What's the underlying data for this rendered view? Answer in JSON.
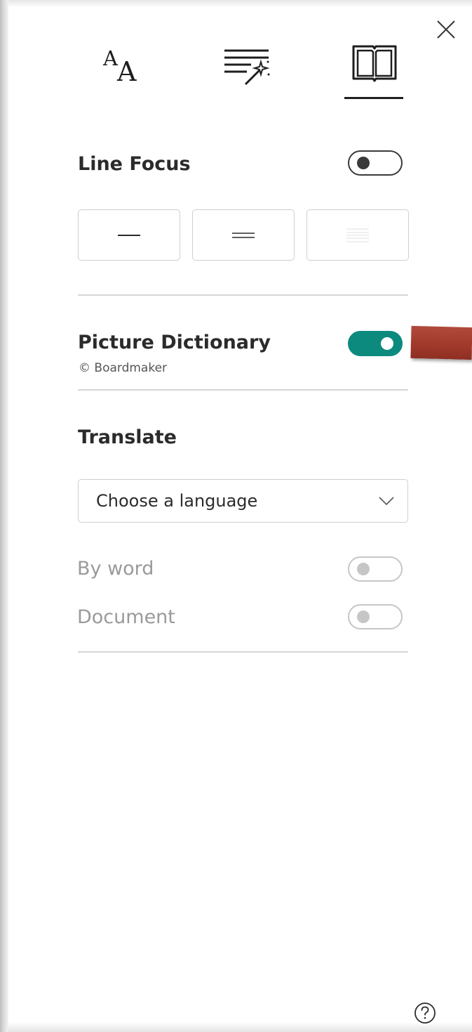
{
  "tabs": [
    {
      "id": "text-preferences",
      "icon": "text-size-icon",
      "label": "AA"
    },
    {
      "id": "grammar-options",
      "icon": "grammar-options-icon"
    },
    {
      "id": "reading-preferences",
      "icon": "book-icon",
      "selected": true
    }
  ],
  "line_focus": {
    "title": "Line Focus",
    "enabled": false,
    "options": [
      {
        "id": "one-line",
        "icon": "one-line-icon"
      },
      {
        "id": "three-lines",
        "icon": "three-lines-icon"
      },
      {
        "id": "five-lines",
        "icon": "five-lines-icon"
      }
    ]
  },
  "picture_dictionary": {
    "title": "Picture Dictionary",
    "credit": "© Boardmaker",
    "enabled": true
  },
  "translate": {
    "title": "Translate",
    "language_placeholder": "Choose a language",
    "by_word_label": "By word",
    "by_word_enabled": false,
    "document_label": "Document",
    "document_enabled": false
  },
  "colors": {
    "accent_toggle": "#0b8a7d",
    "annotation_arrow": "#a23a2b"
  },
  "icons": {
    "close": "close-icon",
    "help": "help-icon",
    "dropdown": "chevron-down-icon"
  }
}
